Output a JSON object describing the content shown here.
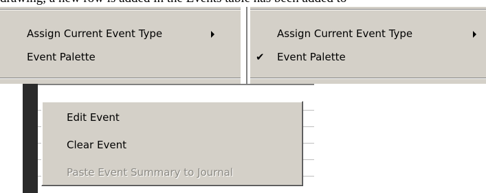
{
  "background_text": "drawing, a new row is added in the Events table has been added to",
  "left_menu": {
    "items": [
      {
        "label": "Assign Current Event Type",
        "submenu": true
      },
      {
        "label": "Event Palette",
        "submenu": false
      }
    ]
  },
  "right_menu": {
    "items": [
      {
        "label": "Assign Current Event Type",
        "submenu": true
      },
      {
        "label": "Event Palette",
        "checked": true,
        "check_glyph": "✔"
      }
    ]
  },
  "context_menu": {
    "items": [
      {
        "label": "Edit Event",
        "disabled": false
      },
      {
        "label": "Clear Event",
        "disabled": false
      },
      {
        "label": "Paste Event Summary to Journal",
        "disabled": true
      }
    ]
  },
  "colors": {
    "menu_bg": "#d4d0c8",
    "disabled_text": "#8c8a84",
    "app_dark": "#2b2b2b"
  },
  "icons": [
    "submenu-arrow-icon",
    "checkmark-icon"
  ]
}
